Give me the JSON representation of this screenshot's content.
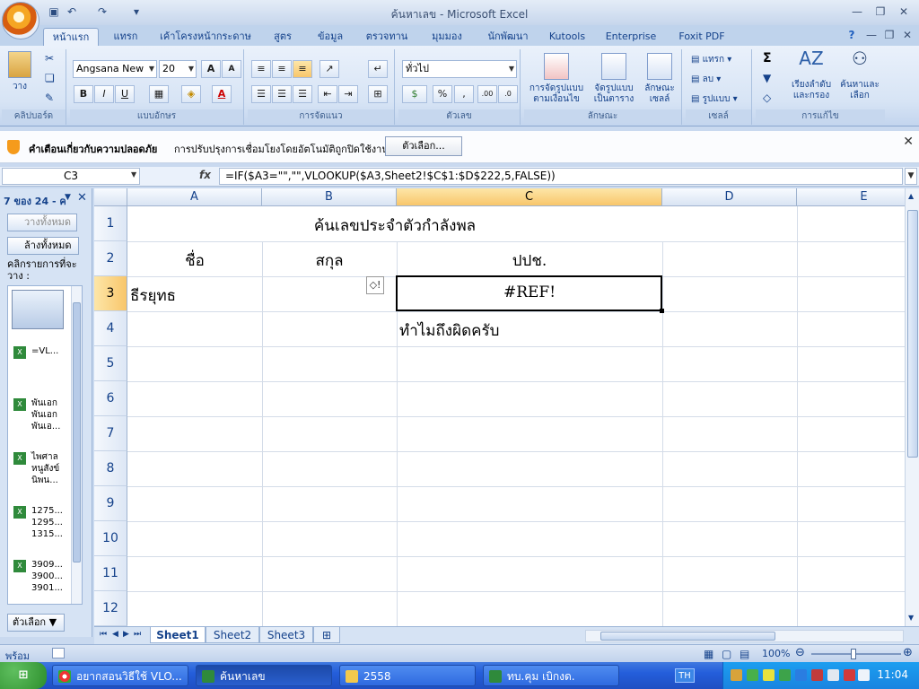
{
  "window": {
    "title": "ค้นหาเลข - Microsoft Excel"
  },
  "ribbon": {
    "tabs": [
      "หน้าแรก",
      "แทรก",
      "เค้าโครงหน้ากระดาษ",
      "สูตร",
      "ข้อมูล",
      "ตรวจทาน",
      "มุมมอง",
      "นักพัฒนา",
      "Kutools",
      "Enterprise",
      "Foxit PDF"
    ],
    "groups": {
      "clipboard": {
        "label": "คลิปบอร์ด",
        "paste": "วาง"
      },
      "font": {
        "label": "แบบอักษร",
        "name": "Angsana New",
        "size": "20"
      },
      "alignment": {
        "label": "การจัดแนว"
      },
      "number": {
        "label": "ตัวเลข",
        "format": "ทั่วไป"
      },
      "styles": {
        "label": "ลักษณะ",
        "cond_format": "การจัดรูปแบบตามเงื่อนไข",
        "format_table": "จัดรูปแบบเป็นตาราง",
        "cell_styles": "ลักษณะเซลล์"
      },
      "cells": {
        "label": "เซลล์",
        "insert": "แทรก",
        "delete": "ลบ",
        "format": "รูปแบบ"
      },
      "editing": {
        "label": "การแก้ไข",
        "sort": "เรียงลำดับและกรอง",
        "find": "ค้นหาและเลือก"
      }
    }
  },
  "security": {
    "title": "คำเตือนเกี่ยวกับความปลอดภัย",
    "message": "การปรับปรุงการเชื่อมโยงโดยอัตโนมัติถูกปิดใช้งาน",
    "options": "ตัวเลือก..."
  },
  "formula_bar": {
    "name_box": "C3",
    "fx": "fx",
    "formula": "=IF($A3=\"\",\"\",VLOOKUP($A3,Sheet2!$C$1:$D$222,5,FALSE))"
  },
  "clipboard_pane": {
    "title": "7 ของ 24 - ค",
    "paste_all": "วางทั้งหมด",
    "clear_all": "ล้างทั้งหมด",
    "hint": "คลิกรายการที่จะวาง :",
    "items": [
      {
        "text": "=VL..."
      },
      {
        "text": "พันเอก พันเอก พันเอ..."
      },
      {
        "text": "ไพศาล หนูสังข์ นิพน..."
      },
      {
        "text": "1275... 1295... 1315..."
      },
      {
        "text": "3909... 3900... 3901..."
      }
    ],
    "options": "ตัวเลือก"
  },
  "grid": {
    "columns": [
      "A",
      "B",
      "C",
      "D",
      "E"
    ],
    "rows": [
      "1",
      "2",
      "3",
      "4",
      "5",
      "6",
      "7",
      "8",
      "9",
      "10",
      "11",
      "12"
    ],
    "cells": {
      "title": "ค้นเลขประจำตัวกำลังพล",
      "h_name": "ชื่อ",
      "h_surname": "สกุล",
      "h_id": "ปปช.",
      "a3": "ธีรยุทธ",
      "c3": "#REF!",
      "c4": "ทำไมถึงผิดครับ"
    }
  },
  "sheets": [
    "Sheet1",
    "Sheet2",
    "Sheet3"
  ],
  "status": {
    "ready": "พร้อม",
    "zoom": "100%"
  },
  "taskbar": {
    "start": "start",
    "tasks": [
      "อยากสอนวิธีใช้ VLO...",
      "ค้นหาเลข",
      "2558",
      "ทบ.คุม เบิกงด."
    ],
    "lang": "TH",
    "clock": "11:04"
  }
}
